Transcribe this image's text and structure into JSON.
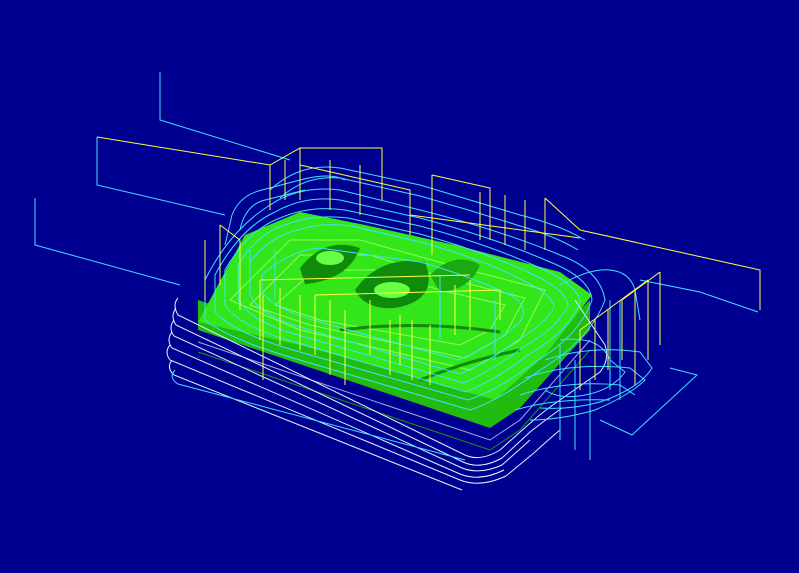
{
  "viewport": {
    "background": "#000090"
  },
  "colors": {
    "part_top": "#33e61a",
    "part_side": "#22bb10",
    "part_dark": "#0f8a0a",
    "cutting_path": "#40e0ff",
    "rapid_move": "#ffff40",
    "outer_pass": "#dff6ff",
    "contour": "#aaff66"
  }
}
